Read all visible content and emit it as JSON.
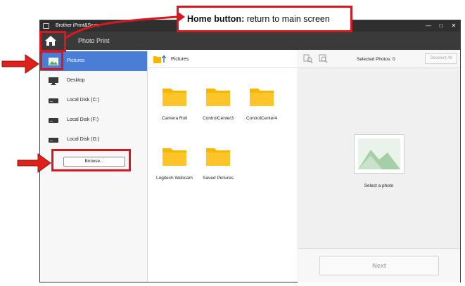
{
  "window": {
    "app_title": "Brother iPrint&Scan",
    "controls": [
      "minimize",
      "maximize",
      "close"
    ],
    "app_icon": "printer-icon"
  },
  "header": {
    "home_icon": "home-icon",
    "page_title": "Photo Print"
  },
  "sidebar": {
    "items": [
      {
        "label": "Pictures",
        "icon": "pictures-icon",
        "active": true
      },
      {
        "label": "Desktop",
        "icon": "desktop-icon",
        "active": false
      },
      {
        "label": "Local Disk (C:)",
        "icon": "drive-icon",
        "active": false
      },
      {
        "label": "Local Disk (F:)",
        "icon": "drive-icon",
        "active": false
      },
      {
        "label": "Local Disk (G:)",
        "icon": "drive-icon",
        "active": false
      }
    ],
    "browse_label": "Browse..."
  },
  "center": {
    "path_label": "Pictures",
    "folders": [
      {
        "name": "Camera Roll"
      },
      {
        "name": "ControlCenter3"
      },
      {
        "name": "ControlCenter4"
      },
      {
        "name": "Logitech Webcam"
      },
      {
        "name": "Saved Pictures"
      }
    ]
  },
  "right": {
    "selected_label": "Selected Photos: 0",
    "deselect_label": "Deselect All",
    "placeholder_label": "Select a photo",
    "next_label": "Next"
  },
  "annotation": {
    "callout_bold": "Home button:",
    "callout_text": " return to main screen",
    "color": "#d7191f"
  },
  "colors": {
    "accent": "#4a7ed6",
    "titlebar": "#2f2f2f",
    "header": "#3a3a3a",
    "folder": "#f5b700"
  }
}
